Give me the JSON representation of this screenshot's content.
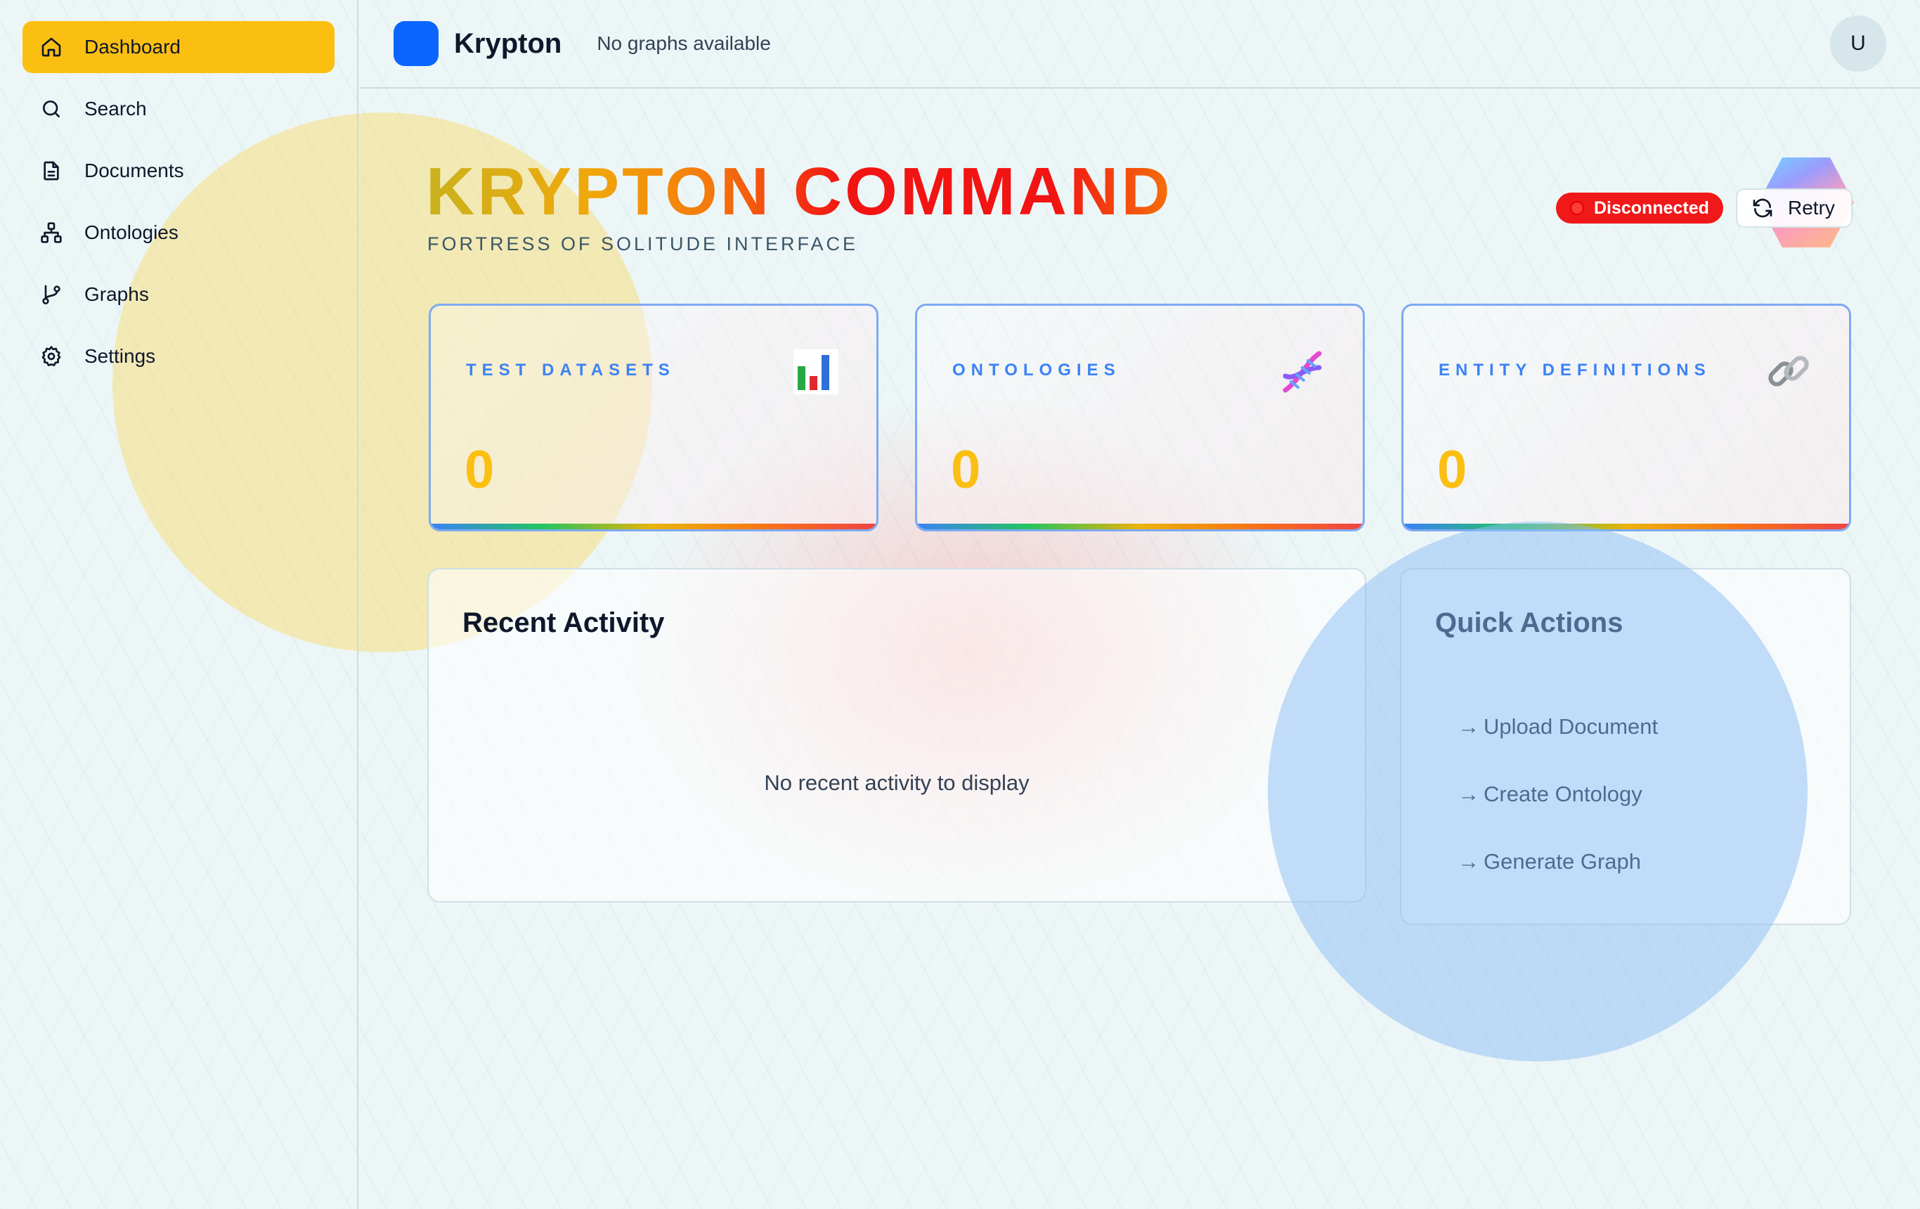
{
  "sidebar": {
    "items": [
      {
        "label": "Dashboard",
        "icon": "home-icon",
        "active": true
      },
      {
        "label": "Search",
        "icon": "search-icon"
      },
      {
        "label": "Documents",
        "icon": "document-icon"
      },
      {
        "label": "Ontologies",
        "icon": "hierarchy-icon"
      },
      {
        "label": "Graphs",
        "icon": "git-branch-icon"
      },
      {
        "label": "Settings",
        "icon": "gear-icon"
      }
    ]
  },
  "header": {
    "brand": "Krypton",
    "graphs_status": "No graphs available",
    "avatar_initial": "U"
  },
  "hero": {
    "title": "KRYPTON COMMAND",
    "subtitle": "FORTRESS OF SOLITUDE INTERFACE"
  },
  "connection": {
    "status": "Disconnected",
    "retry_label": "Retry",
    "status_color": "#f01818"
  },
  "stats": [
    {
      "label": "TEST DATASETS",
      "value": "0",
      "icon": "bar-chart-icon"
    },
    {
      "label": "ONTOLOGIES",
      "value": "0",
      "icon": "dna-icon"
    },
    {
      "label": "ENTITY DEFINITIONS",
      "value": "0",
      "icon": "link-icon"
    }
  ],
  "recent_activity": {
    "title": "Recent Activity",
    "empty_text": "No recent activity to display"
  },
  "quick_actions": {
    "title": "Quick Actions",
    "arrow": "→",
    "items": [
      {
        "label": "Upload Document"
      },
      {
        "label": "Create Ontology"
      },
      {
        "label": "Generate Graph"
      }
    ]
  },
  "colors": {
    "accent": "#fbbf12",
    "brand_blue": "#0a66ff",
    "stat_label": "#3b82f6"
  }
}
